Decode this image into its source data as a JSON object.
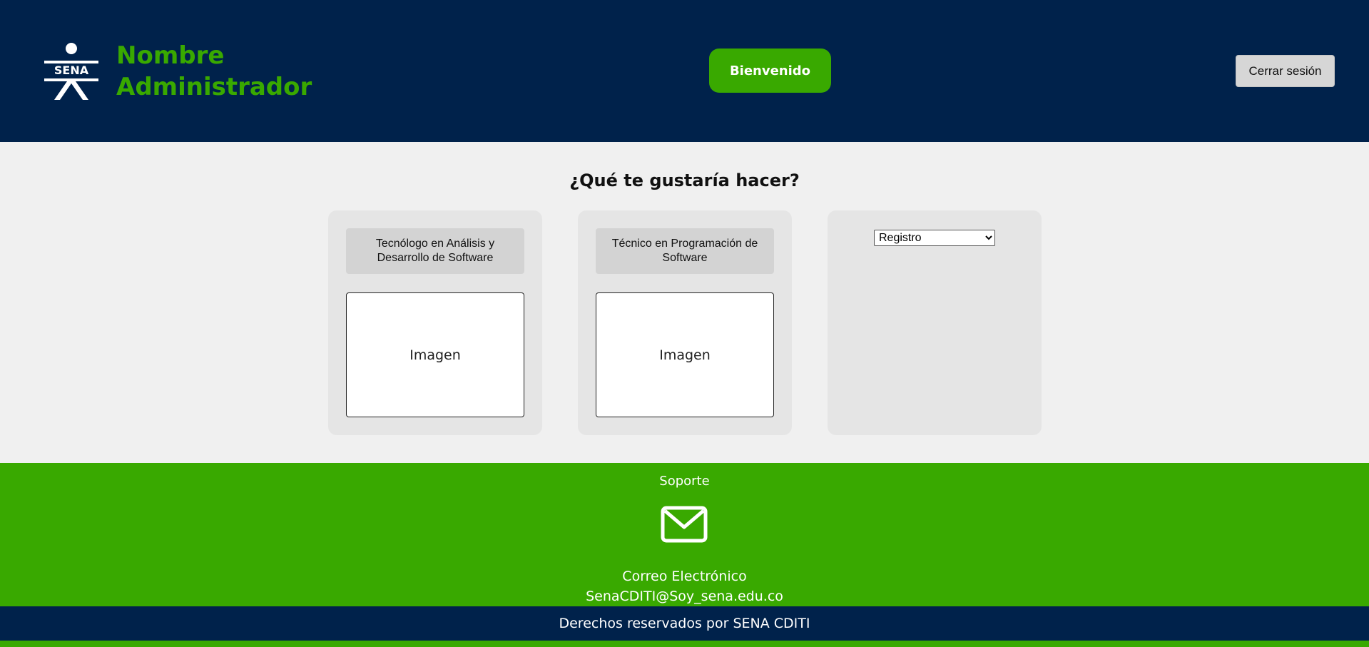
{
  "header": {
    "brand_line1": "Nombre",
    "brand_line2": "Administrador",
    "welcome_label": "Bienvenido",
    "logout_label": "Cerrar sesión"
  },
  "main": {
    "question": "¿Qué te gustaría hacer?",
    "cards": [
      {
        "title": "Tecnólogo en Análisis y Desarrollo de Software",
        "image_label": "Imagen"
      },
      {
        "title": "Técnico en Programación de Software",
        "image_label": "Imagen"
      }
    ],
    "select": {
      "selected": "Registro"
    }
  },
  "footer": {
    "support_label": "Soporte",
    "email_icon": "envelope-icon",
    "email_label": "Correo Electrónico",
    "email_address": "SenaCDITI@Soy_sena.edu.co",
    "copyright": "Derechos reservados por SENA CDITI"
  },
  "colors": {
    "navy": "#00224b",
    "green": "#39a900",
    "card_bg": "#e5e5e5",
    "page_bg": "#f0f0f0"
  }
}
